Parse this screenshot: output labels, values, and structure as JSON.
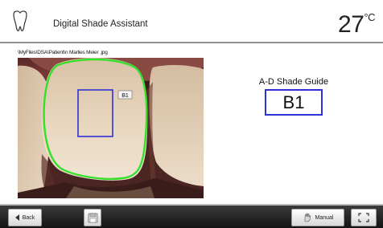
{
  "header": {
    "title": "Digital Shade Assistant",
    "temperature": "27",
    "temperature_unit": "°C",
    "icon": "tooth-icon"
  },
  "image_path": "\\MyFiles\\DSA\\Patient\\n Marlies Meier .jpg",
  "photo": {
    "region_label": "B1"
  },
  "shade_guide": {
    "label": "A-D Shade Guide",
    "value": "B1"
  },
  "footer": {
    "back_label": "Back",
    "manual_label": "Manual",
    "icons": [
      "back-arrow-icon",
      "save-disk-icon",
      "manual-hand-icon",
      "fullscreen-icon"
    ]
  },
  "colors": {
    "outline_green": "#33e02a",
    "selection_blue": "#2d31d8",
    "footer_bar": "#1f1f1f"
  }
}
